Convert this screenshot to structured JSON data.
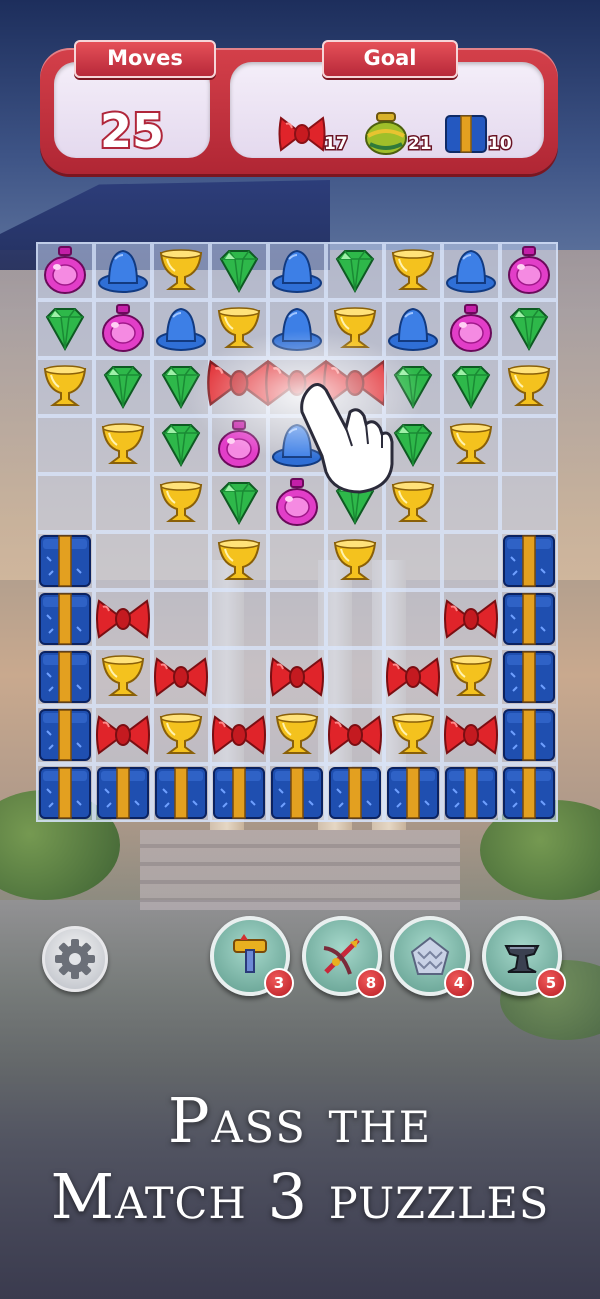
{
  "hud": {
    "moves_label": "Moves",
    "moves_value": "25",
    "goal_label": "Goal",
    "goals": [
      {
        "icon": "red-bow-icon",
        "count": "17"
      },
      {
        "icon": "green-vase-icon",
        "count": "21"
      },
      {
        "icon": "blue-gift-box-icon",
        "count": "10"
      }
    ]
  },
  "boosters": {
    "settings_icon": "gear-icon",
    "items": [
      {
        "icon": "hammer-icon",
        "count": "3"
      },
      {
        "icon": "crossbow-icon",
        "count": "8"
      },
      {
        "icon": "diamond-cluster-icon",
        "count": "4"
      },
      {
        "icon": "anvil-icon",
        "count": "5"
      }
    ]
  },
  "caption": {
    "line1": "Pass the",
    "line2": "Match 3 puzzles"
  },
  "colors": {
    "hud_red": "#c8323e",
    "panel": "#efe7f5",
    "gem_green": "#2eb84a",
    "hat_blue": "#2f6fd6",
    "cup_yellow": "#f4c21e",
    "potion_pink": "#e23ec8",
    "bow_red": "#e0242a",
    "gift_blue": "#1f4fb0"
  },
  "board": {
    "rows": [
      [
        "potion",
        "hat",
        "cup",
        "gem",
        "hat",
        "gem",
        "cup",
        "hat",
        "potion"
      ],
      [
        "gem",
        "potion",
        "hat",
        "cup",
        "hat",
        "cup",
        "hat",
        "potion",
        "gem"
      ],
      [
        "cup",
        "gem",
        "gem",
        "bow",
        "bow",
        "bow",
        "gem",
        "gem",
        "cup"
      ],
      [
        null,
        "cup",
        "gem",
        "potion",
        "hat",
        "gem",
        "gem",
        "cup",
        null
      ],
      [
        null,
        null,
        "cup",
        "gem",
        "potion",
        "gem",
        "cup",
        null,
        null
      ],
      [
        "gift",
        null,
        null,
        "cup",
        null,
        "cup",
        null,
        null,
        "gift"
      ],
      [
        "gift",
        "bow",
        null,
        null,
        null,
        null,
        null,
        "bow",
        "gift"
      ],
      [
        "gift",
        "cup",
        "bow",
        null,
        "bow",
        null,
        "bow",
        "cup",
        "gift"
      ],
      [
        "gift",
        "bow",
        "cup",
        "bow",
        "cup",
        "bow",
        "cup",
        "bow",
        "gift"
      ],
      [
        "gift",
        "gift",
        "gift",
        "gift",
        "gift",
        "gift",
        "gift",
        "gift",
        "gift"
      ]
    ]
  }
}
